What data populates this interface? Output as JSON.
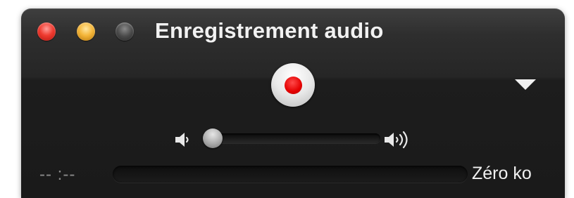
{
  "window": {
    "title": "Enregistrement audio"
  },
  "titlebar": {
    "buttons": [
      {
        "name": "close",
        "color": "#ef3b30"
      },
      {
        "name": "minimize",
        "color": "#f4b63a"
      },
      {
        "name": "zoom",
        "color": "#4a4a4a"
      }
    ]
  },
  "controls": {
    "record_icon": "record-icon",
    "record_color": "#e40000",
    "options_icon": "triangle-down-icon"
  },
  "volume": {
    "low_icon": "speaker-low-icon",
    "high_icon": "speaker-high-icon",
    "level": 0.0
  },
  "status": {
    "time": "-- :--",
    "size": "Zéro ko"
  }
}
